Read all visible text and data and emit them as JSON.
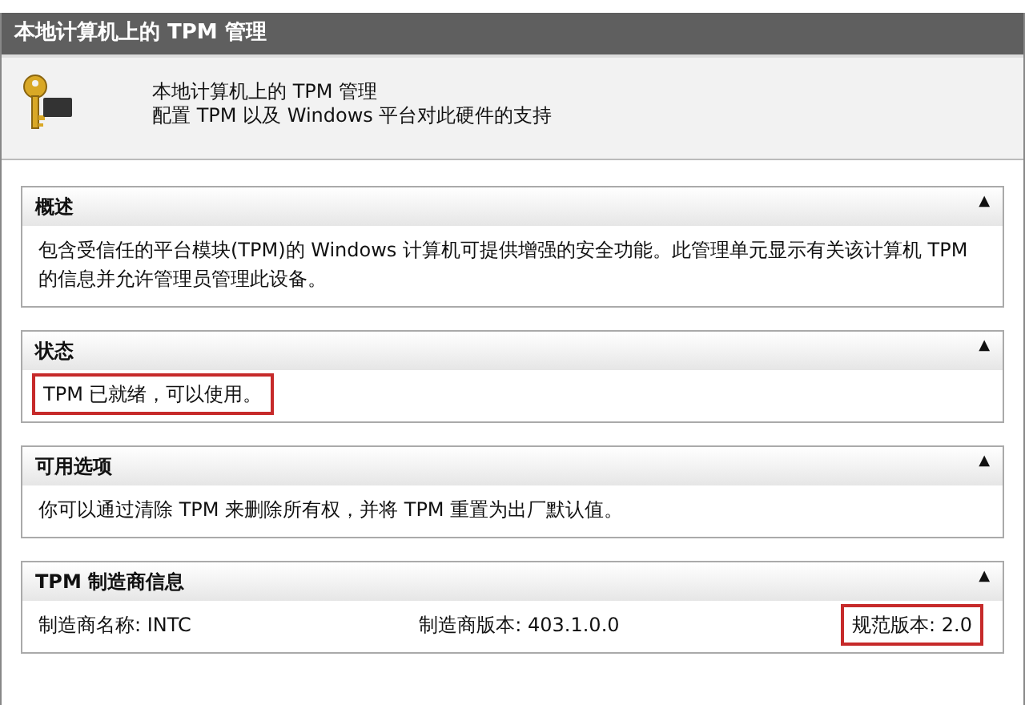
{
  "window": {
    "title": "本地计算机上的 TPM 管理"
  },
  "header": {
    "title": "本地计算机上的 TPM 管理",
    "subtitle": "配置 TPM 以及 Windows 平台对此硬件的支持"
  },
  "sections": [
    {
      "title": "概述",
      "toggle": "▲",
      "kind": "text",
      "text": "包含受信任的平台模块(TPM)的 Windows 计算机可提供增强的安全功能。此管理单元显示有关该计算机 TPM 的信息并允许管理员管理此设备。",
      "highlighted": false
    },
    {
      "title": "状态",
      "toggle": "▲",
      "kind": "text",
      "text": "TPM 已就绪，可以使用。",
      "highlighted": true
    },
    {
      "title": "可用选项",
      "toggle": "▲",
      "kind": "text",
      "text": "你可以通过清除 TPM 来删除所有权，并将 TPM 重置为出厂默认值。",
      "highlighted": false
    },
    {
      "title": "TPM 制造商信息",
      "toggle": "▲",
      "kind": "fields",
      "fields": [
        {
          "text": "制造商名称: INTC",
          "highlighted": false
        },
        {
          "text": "制造商版本: 403.1.0.0",
          "highlighted": false
        },
        {
          "text": "规范版本: 2.0",
          "highlighted": true
        }
      ]
    }
  ]
}
